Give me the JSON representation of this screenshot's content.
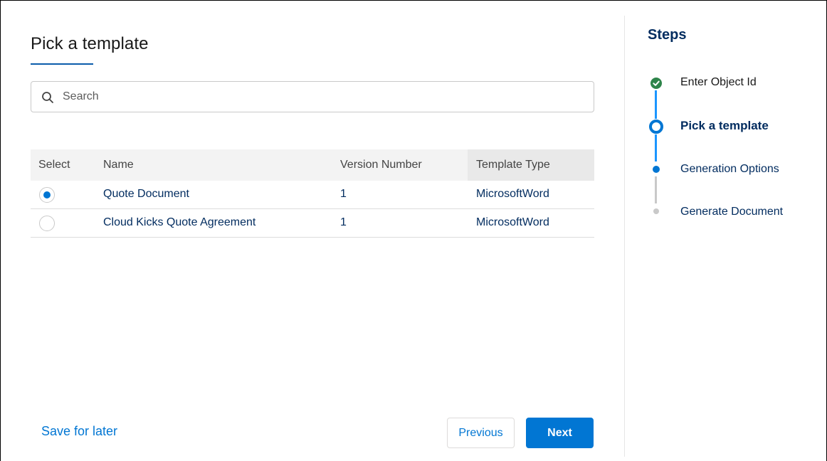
{
  "main": {
    "title": "Pick a template",
    "search": {
      "placeholder": "Search",
      "value": ""
    },
    "table": {
      "columns": [
        "Select",
        "Name",
        "Version Number",
        "Template Type"
      ],
      "rows": [
        {
          "selected": true,
          "name": "Quote Document",
          "version": "1",
          "type": "MicrosoftWord"
        },
        {
          "selected": false,
          "name": "Cloud Kicks Quote Agreement",
          "version": "1",
          "type": "MicrosoftWord"
        }
      ]
    },
    "footer": {
      "save_label": "Save for later",
      "previous_label": "Previous",
      "next_label": "Next"
    }
  },
  "steps": {
    "title": "Steps",
    "items": [
      {
        "label": "Enter Object Id",
        "status": "complete",
        "icon": "check-icon"
      },
      {
        "label": "Pick a template",
        "status": "current",
        "icon": "ring-icon"
      },
      {
        "label": "Generation Options",
        "status": "next",
        "icon": "dot-icon"
      },
      {
        "label": "Generate Document",
        "status": "upcoming",
        "icon": "dot-icon"
      }
    ]
  },
  "colors": {
    "brand": "#0176d3",
    "complete": "#2e844a",
    "heading": "#032d60",
    "inactive": "#c9c9c9"
  }
}
